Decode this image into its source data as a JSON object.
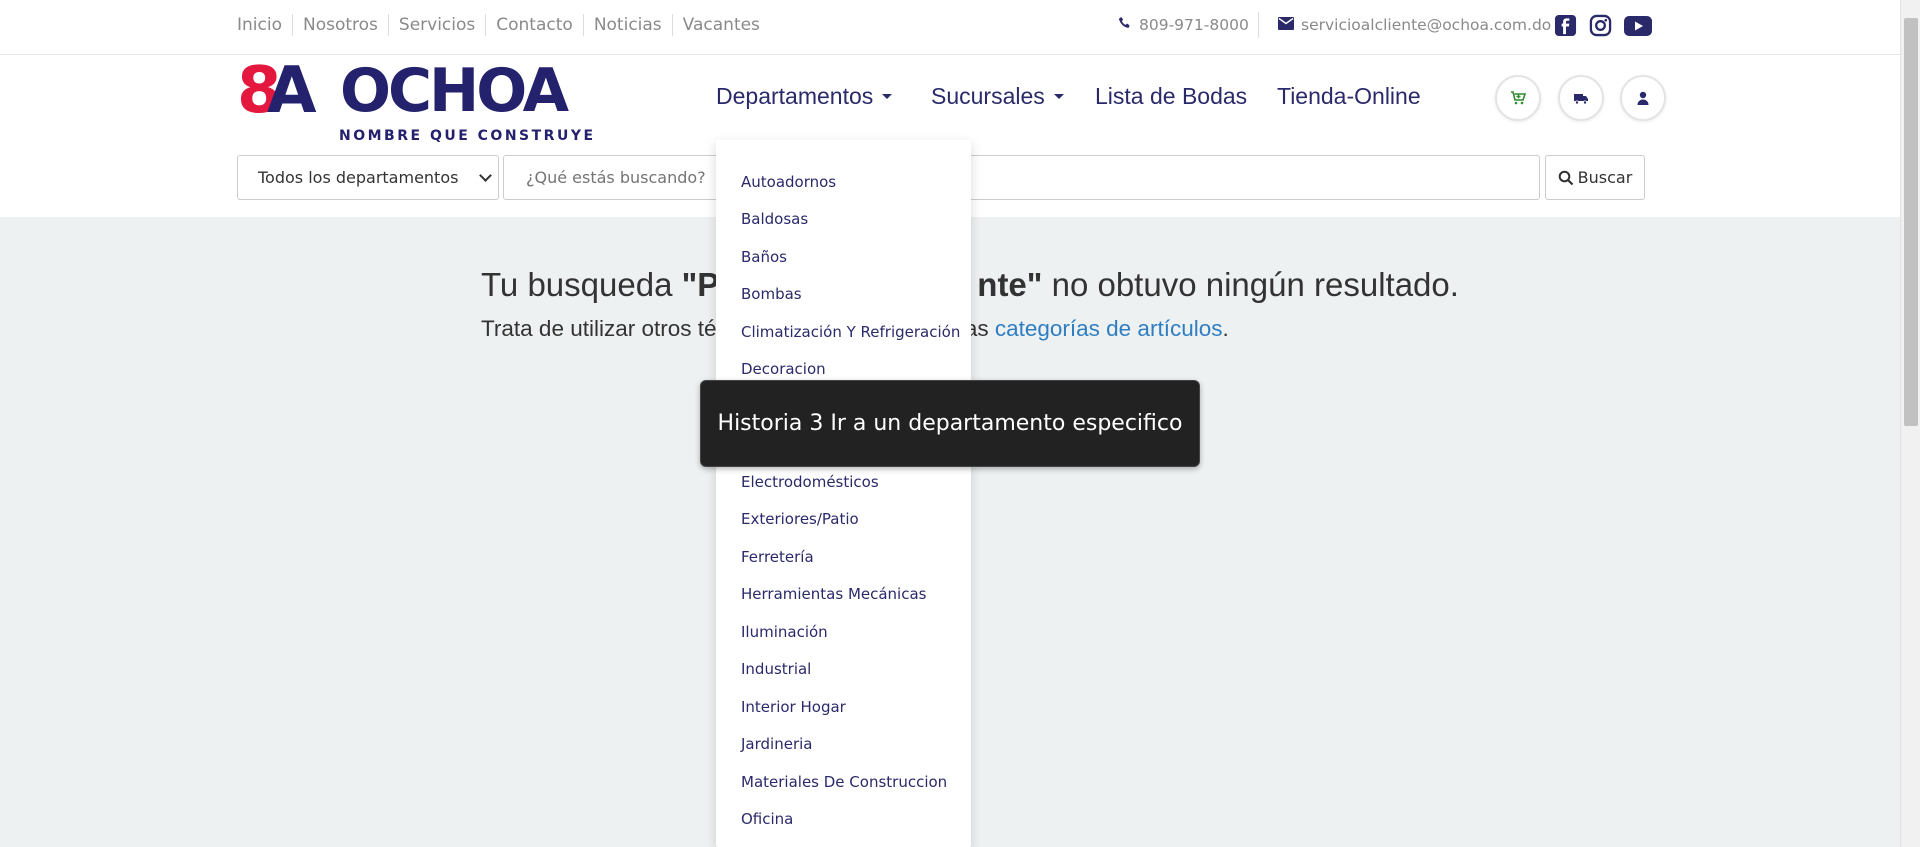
{
  "topbar": {
    "links": [
      "Inicio",
      "Nosotros",
      "Servicios",
      "Contacto",
      "Noticias",
      "Vacantes"
    ],
    "phone": "809-971-8000",
    "email": "servicioalcliente@ochoa.com.do",
    "social_icons": [
      "facebook-icon",
      "instagram-icon",
      "youtube-icon"
    ]
  },
  "logo": {
    "mark": "8A",
    "name": "OCHOA",
    "tagline": "NOMBRE QUE CONSTRUYE",
    "colors": {
      "red": "#e4173f",
      "navy": "#24216d"
    }
  },
  "nav": {
    "departamentos": "Departamentos",
    "sucursales": "Sucursales",
    "bodas": "Lista de Bodas",
    "tienda": "Tienda-Online"
  },
  "header_icons": [
    "cart-icon",
    "truck-icon",
    "user-icon"
  ],
  "search": {
    "department_value": "Todos los departamentos",
    "placeholder": "¿Qué estás buscando?",
    "button_label": "Buscar"
  },
  "result": {
    "prefix": "Tu busqueda ",
    "query_visible": "\"P",
    "query_end": "nte\"",
    "suffix": " no obtuvo ningún resultado.",
    "sub_prefix": "Trata de utilizar otros té",
    "sub_mid": "e nuestras ",
    "sub_link": "categorías de artículos",
    "sub_end": "."
  },
  "dropdown": {
    "items": [
      "Autoadornos",
      "Baldosas",
      "Baños",
      "Bombas",
      "Climatización Y Refrigeración",
      "Decoracion",
      "Electrodomésticos",
      "Exteriores/Patio",
      "Ferretería",
      "Herramientas Mecánicas",
      "Iluminación",
      "Industrial",
      "Interior Hogar",
      "Jardineria",
      "Materiales De Construccion",
      "Oficina"
    ]
  },
  "tooltip": {
    "text": "Historia 3 Ir a un departamento especifico"
  },
  "accent_colors": {
    "nav_text": "#2a2a6a",
    "link": "#2f7ec1",
    "cart_green": "#2e8b2e"
  }
}
